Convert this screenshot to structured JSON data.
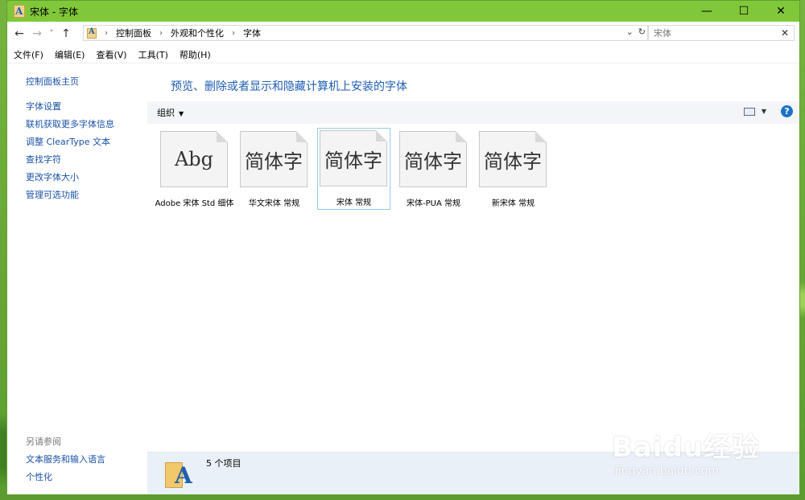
{
  "window": {
    "title": "宋体 - 字体",
    "controls": {
      "minimize": "—",
      "maximize": "☐",
      "close": "✕"
    }
  },
  "nav": {
    "back": "←",
    "forward": "→",
    "recent": "˅",
    "up": "↑",
    "breadcrumbs": [
      "控制面板",
      "外观和个性化",
      "字体"
    ],
    "search_placeholder": "宋体",
    "search_clear": "✕"
  },
  "menu": [
    "文件(F)",
    "编辑(E)",
    "查看(V)",
    "工具(T)",
    "帮助(H)"
  ],
  "sidebar": {
    "home": "控制面板主页",
    "links": [
      "字体设置",
      "联机获取更多字体信息",
      "调整 ClearType 文本",
      "查找字符",
      "更改字体大小",
      "管理可选功能"
    ],
    "see_also_title": "另请参阅",
    "see_also": [
      "文本服务和输入语言",
      "个性化"
    ]
  },
  "main": {
    "header": "预览、删除或者显示和隐藏计算机上安装的字体",
    "organize_label": "组织",
    "fonts": [
      {
        "preview": "Abg",
        "name": "Adobe 宋体 Std 细体",
        "selected": false
      },
      {
        "preview": "简体字",
        "name": "华文宋体 常规",
        "selected": false
      },
      {
        "preview": "简体字",
        "name": "宋体 常规",
        "selected": true
      },
      {
        "preview": "简体字",
        "name": "宋体-PUA 常规",
        "selected": false
      },
      {
        "preview": "简体字",
        "name": "新宋体 常规",
        "selected": false
      }
    ],
    "item_count": "5 个项目"
  },
  "watermark": {
    "logo": "Baidu经验",
    "url": "jingyan.baidu.com"
  },
  "colors": {
    "titlebar": "#80c73a",
    "link": "#1a52a8",
    "header": "#1e5eb3",
    "selection_border": "#99c8f0",
    "details_bg": "#eaf0f8"
  }
}
